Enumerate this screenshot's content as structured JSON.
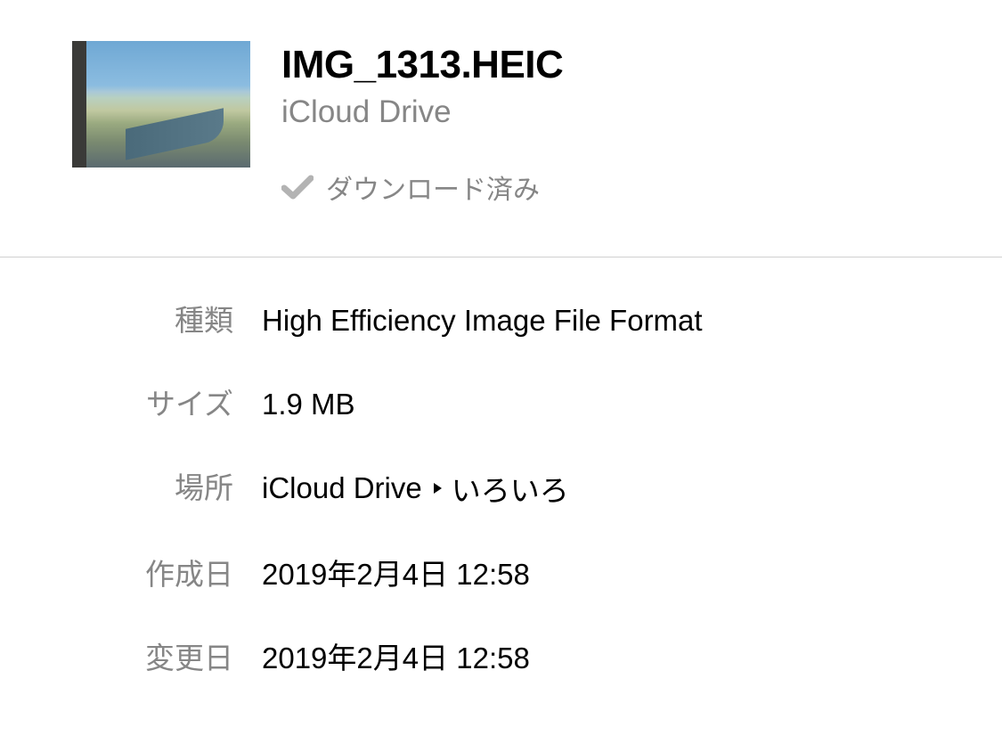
{
  "header": {
    "filename": "IMG_1313.HEIC",
    "subtitle": "iCloud Drive",
    "status_text": "ダウンロード済み"
  },
  "info": {
    "labels": {
      "kind": "種類",
      "size": "サイズ",
      "location": "場所",
      "created": "作成日",
      "modified": "変更日"
    },
    "values": {
      "kind": "High Efficiency Image File Format",
      "size": "1.9 MB",
      "location_root": "iCloud Drive",
      "location_sub": "いろいろ",
      "created": "2019年2月4日 12:58",
      "modified": "2019年2月4日 12:58"
    }
  }
}
